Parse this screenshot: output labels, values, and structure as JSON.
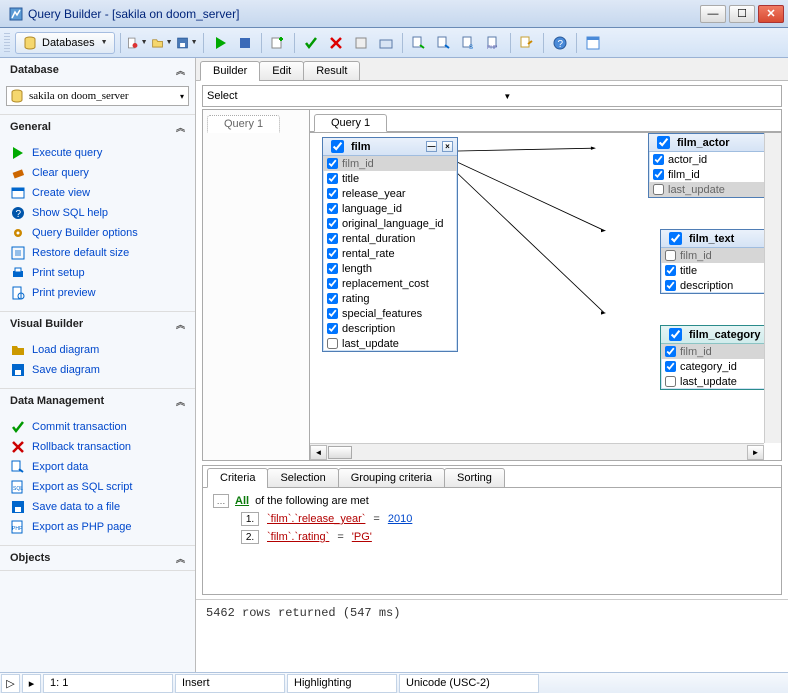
{
  "window": {
    "title": "Query Builder - [sakila on doom_server]"
  },
  "toolbar": {
    "databases_label": "Databases"
  },
  "sidebar": {
    "database": {
      "title": "Database",
      "selected": "sakila on doom_server"
    },
    "general": {
      "title": "General",
      "items": [
        {
          "label": "Execute query",
          "icon": "play",
          "color": "#0a0"
        },
        {
          "label": "Clear query",
          "icon": "eraser",
          "color": "#c60"
        },
        {
          "label": "Create view",
          "icon": "view",
          "color": "#06c"
        },
        {
          "label": "Show SQL help",
          "icon": "help",
          "color": "#05a"
        },
        {
          "label": "Query Builder options",
          "icon": "gear",
          "color": "#c80"
        },
        {
          "label": "Restore default size",
          "icon": "resize",
          "color": "#06c"
        },
        {
          "label": "Print setup",
          "icon": "print",
          "color": "#06c"
        },
        {
          "label": "Print preview",
          "icon": "preview",
          "color": "#06c"
        }
      ]
    },
    "visual": {
      "title": "Visual Builder",
      "items": [
        {
          "label": "Load diagram",
          "icon": "open",
          "color": "#c90"
        },
        {
          "label": "Save diagram",
          "icon": "save",
          "color": "#06c"
        }
      ]
    },
    "datamgmt": {
      "title": "Data Management",
      "items": [
        {
          "label": "Commit transaction",
          "icon": "check",
          "color": "#090"
        },
        {
          "label": "Rollback transaction",
          "icon": "x",
          "color": "#c00"
        },
        {
          "label": "Export data",
          "icon": "export",
          "color": "#06c"
        },
        {
          "label": "Export as SQL script",
          "icon": "sql",
          "color": "#06c"
        },
        {
          "label": "Save data to a file",
          "icon": "savefile",
          "color": "#06c"
        },
        {
          "label": "Export as PHP page",
          "icon": "php",
          "color": "#06c"
        }
      ]
    },
    "objects": {
      "title": "Objects"
    }
  },
  "view_tabs": [
    "Builder",
    "Edit",
    "Result"
  ],
  "select_label": "Select",
  "qtab_left": "Query 1",
  "qtab_right": "Query 1",
  "entities": {
    "film": {
      "name": "film",
      "cols": [
        {
          "n": "film_id",
          "c": true,
          "sel": true
        },
        {
          "n": "title",
          "c": true
        },
        {
          "n": "release_year",
          "c": true
        },
        {
          "n": "language_id",
          "c": true
        },
        {
          "n": "original_language_id",
          "c": true
        },
        {
          "n": "rental_duration",
          "c": true
        },
        {
          "n": "rental_rate",
          "c": true
        },
        {
          "n": "length",
          "c": true
        },
        {
          "n": "replacement_cost",
          "c": true
        },
        {
          "n": "rating",
          "c": true
        },
        {
          "n": "special_features",
          "c": true
        },
        {
          "n": "description",
          "c": true
        },
        {
          "n": "last_update",
          "c": false
        }
      ]
    },
    "film_actor": {
      "name": "film_actor",
      "cols": [
        {
          "n": "actor_id",
          "c": true
        },
        {
          "n": "film_id",
          "c": true
        },
        {
          "n": "last_update",
          "c": false,
          "sel": true
        }
      ]
    },
    "film_text": {
      "name": "film_text",
      "cols": [
        {
          "n": "film_id",
          "c": false,
          "sel": true
        },
        {
          "n": "title",
          "c": true
        },
        {
          "n": "description",
          "c": true
        }
      ]
    },
    "film_category": {
      "name": "film_category",
      "cols": [
        {
          "n": "film_id",
          "c": true,
          "sel": true
        },
        {
          "n": "category_id",
          "c": true
        },
        {
          "n": "last_update",
          "c": false
        }
      ]
    }
  },
  "criteria_tabs": [
    "Criteria",
    "Selection",
    "Grouping criteria",
    "Sorting"
  ],
  "criteria": {
    "root_label": "All",
    "root_suffix": "of the following are met",
    "lines": [
      {
        "num": "1.",
        "field": "`film`.`release_year`",
        "op": "=",
        "value": "2010"
      },
      {
        "num": "2.",
        "field": "`film`.`rating`",
        "op": "=",
        "value": "'PG'",
        "valcls": "pg"
      }
    ]
  },
  "status_msg": "5462 rows returned (547 ms)",
  "statusbar": {
    "pos": "1:   1",
    "mode": "Insert",
    "highlight": "Highlighting",
    "encoding": "Unicode (USC-2)"
  }
}
